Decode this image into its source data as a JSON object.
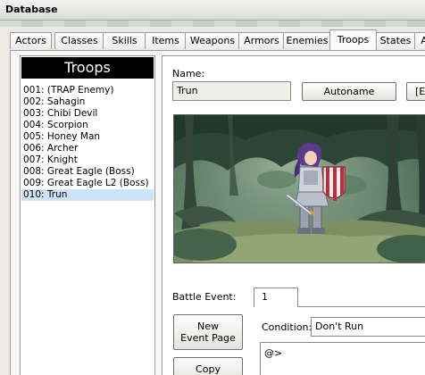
{
  "window": {
    "title": "Database"
  },
  "tabs": [
    {
      "label": "Actors"
    },
    {
      "label": "Classes"
    },
    {
      "label": "Skills"
    },
    {
      "label": "Items"
    },
    {
      "label": "Weapons"
    },
    {
      "label": "Armors"
    },
    {
      "label": "Enemies"
    },
    {
      "label": "Troops"
    },
    {
      "label": "States"
    },
    {
      "label": "A"
    }
  ],
  "active_tab": "Troops",
  "troops_panel": {
    "header": "Troops",
    "items": [
      {
        "label": "001: (TRAP Enemy)"
      },
      {
        "label": "002: Sahagin"
      },
      {
        "label": "003: Chibi Devil"
      },
      {
        "label": "004: Scorpion"
      },
      {
        "label": "005: Honey Man"
      },
      {
        "label": "006: Archer"
      },
      {
        "label": "007: Knight"
      },
      {
        "label": "008: Great Eagle (Boss)"
      },
      {
        "label": "009: Great Eagle L2 (Boss)"
      },
      {
        "label": "010: Trun"
      }
    ],
    "selected": "010: Trun"
  },
  "detail": {
    "name_label": "Name:",
    "name_value": "Trun",
    "autoname_label": "Autoname",
    "cut_button_label": "[E",
    "battle_event_label": "Battle Event:",
    "page_tab_label": "1",
    "new_event_page_label_1": "New",
    "new_event_page_label_2": "Event Page",
    "copy_label": "Copy",
    "condition_label": "Condition:",
    "condition_value": "Don't Run",
    "event_command_line": "@>"
  },
  "colors": {
    "header_bg": "#000000",
    "selection": "#cde4f7",
    "forest_dark": "#2f4a3c",
    "forest_light": "#6d8e77",
    "knight_armor": "#cfd3da",
    "shield_red": "#c8283a",
    "hair_purple": "#5a3a8c"
  }
}
